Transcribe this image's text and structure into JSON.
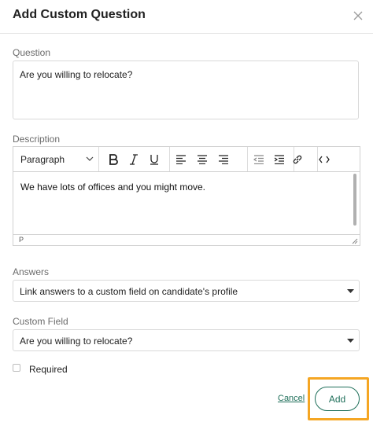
{
  "dialog": {
    "title": "Add Custom Question",
    "close_icon": "close-icon"
  },
  "question": {
    "label": "Question",
    "value": "Are you willing to relocate?"
  },
  "description": {
    "label": "Description",
    "toolbar": {
      "format_value": "Paragraph",
      "buttons": [
        "bold-icon",
        "italic-icon",
        "underline-icon",
        "align-left-icon",
        "align-center-icon",
        "align-right-icon",
        "outdent-icon",
        "indent-icon",
        "link-icon",
        "code-icon"
      ]
    },
    "content": "We have lots of offices and you might move.",
    "status_path": "P"
  },
  "answers": {
    "label": "Answers",
    "selected": "Link answers to a custom field on candidate's profile"
  },
  "custom_field": {
    "label": "Custom Field",
    "selected": "Are you willing to relocate?"
  },
  "required": {
    "label": "Required",
    "checked": false
  },
  "footer": {
    "cancel_label": "Cancel",
    "add_label": "Add",
    "highlight_color": "#f5a623",
    "accent_color": "#1f6f5a"
  }
}
